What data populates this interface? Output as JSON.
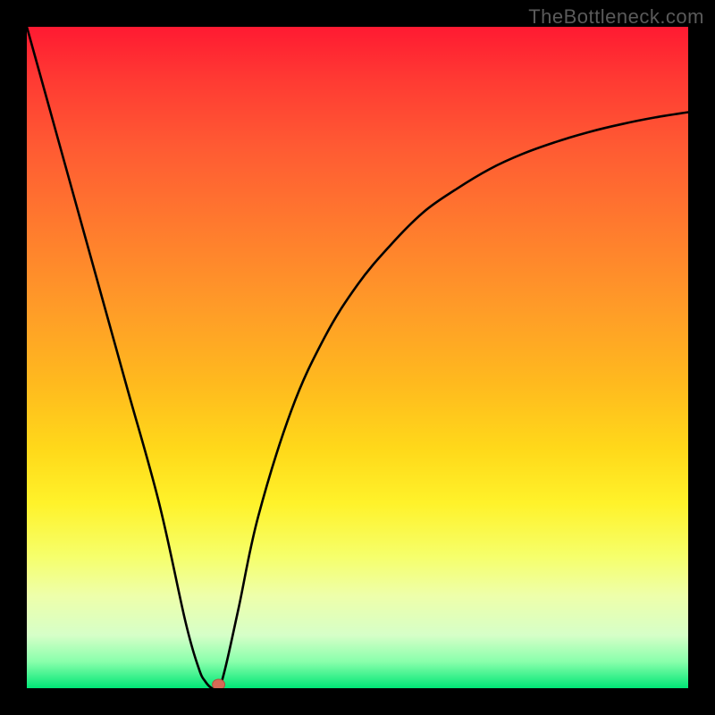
{
  "watermark": "TheBottleneck.com",
  "chart_data": {
    "type": "line",
    "title": "",
    "xlabel": "",
    "ylabel": "",
    "xlim": [
      0,
      100
    ],
    "ylim": [
      0,
      100
    ],
    "grid": false,
    "series": [
      {
        "name": "curve",
        "x": [
          0,
          5,
          10,
          15,
          20,
          24,
          26,
          27,
          28,
          29,
          30,
          32,
          35,
          40,
          45,
          50,
          55,
          60,
          65,
          70,
          75,
          80,
          85,
          90,
          95,
          100
        ],
        "y": [
          100,
          82,
          64,
          46,
          28,
          10,
          3,
          1,
          0,
          0,
          3,
          12,
          26,
          42,
          53,
          61,
          67,
          72,
          75.5,
          78.5,
          80.8,
          82.6,
          84.1,
          85.3,
          86.3,
          87.1
        ]
      }
    ],
    "marker": {
      "x": 29,
      "y": 0,
      "color": "#d66a56"
    },
    "background_gradient": {
      "stops": [
        {
          "pos": 0.0,
          "color": "#ff1a32"
        },
        {
          "pos": 0.5,
          "color": "#ffc71e"
        },
        {
          "pos": 0.85,
          "color": "#f2ff90"
        },
        {
          "pos": 1.0,
          "color": "#00e676"
        }
      ]
    }
  }
}
